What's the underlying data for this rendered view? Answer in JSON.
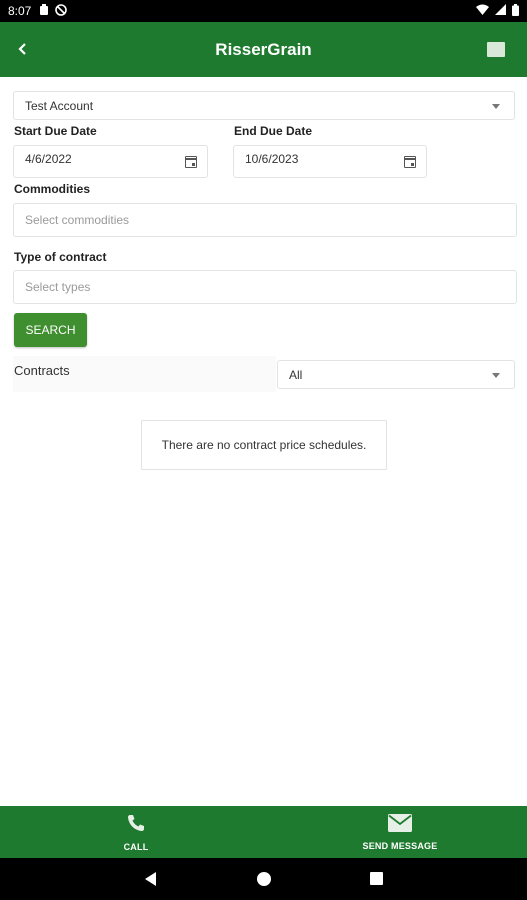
{
  "statusbar": {
    "time": "8:07"
  },
  "appbar": {
    "title": "RisserGrain"
  },
  "account": {
    "selected": "Test Account"
  },
  "start_due_date": {
    "label": "Start Due Date",
    "value": "4/6/2022"
  },
  "end_due_date": {
    "label": "End Due Date",
    "value": "10/6/2023"
  },
  "commodities": {
    "label": "Commodities",
    "placeholder": "Select commodities"
  },
  "contract_type": {
    "label": "Type of contract",
    "placeholder": "Select types"
  },
  "search_button": {
    "label": "SEARCH"
  },
  "contracts": {
    "label": "Contracts",
    "filter_value": "All"
  },
  "empty_message": "There are no contract price schedules.",
  "actions": {
    "call": "CALL",
    "send_message": "SEND MESSAGE"
  },
  "colors": {
    "primary": "#1e7a2e",
    "button": "#3f8e2f"
  }
}
